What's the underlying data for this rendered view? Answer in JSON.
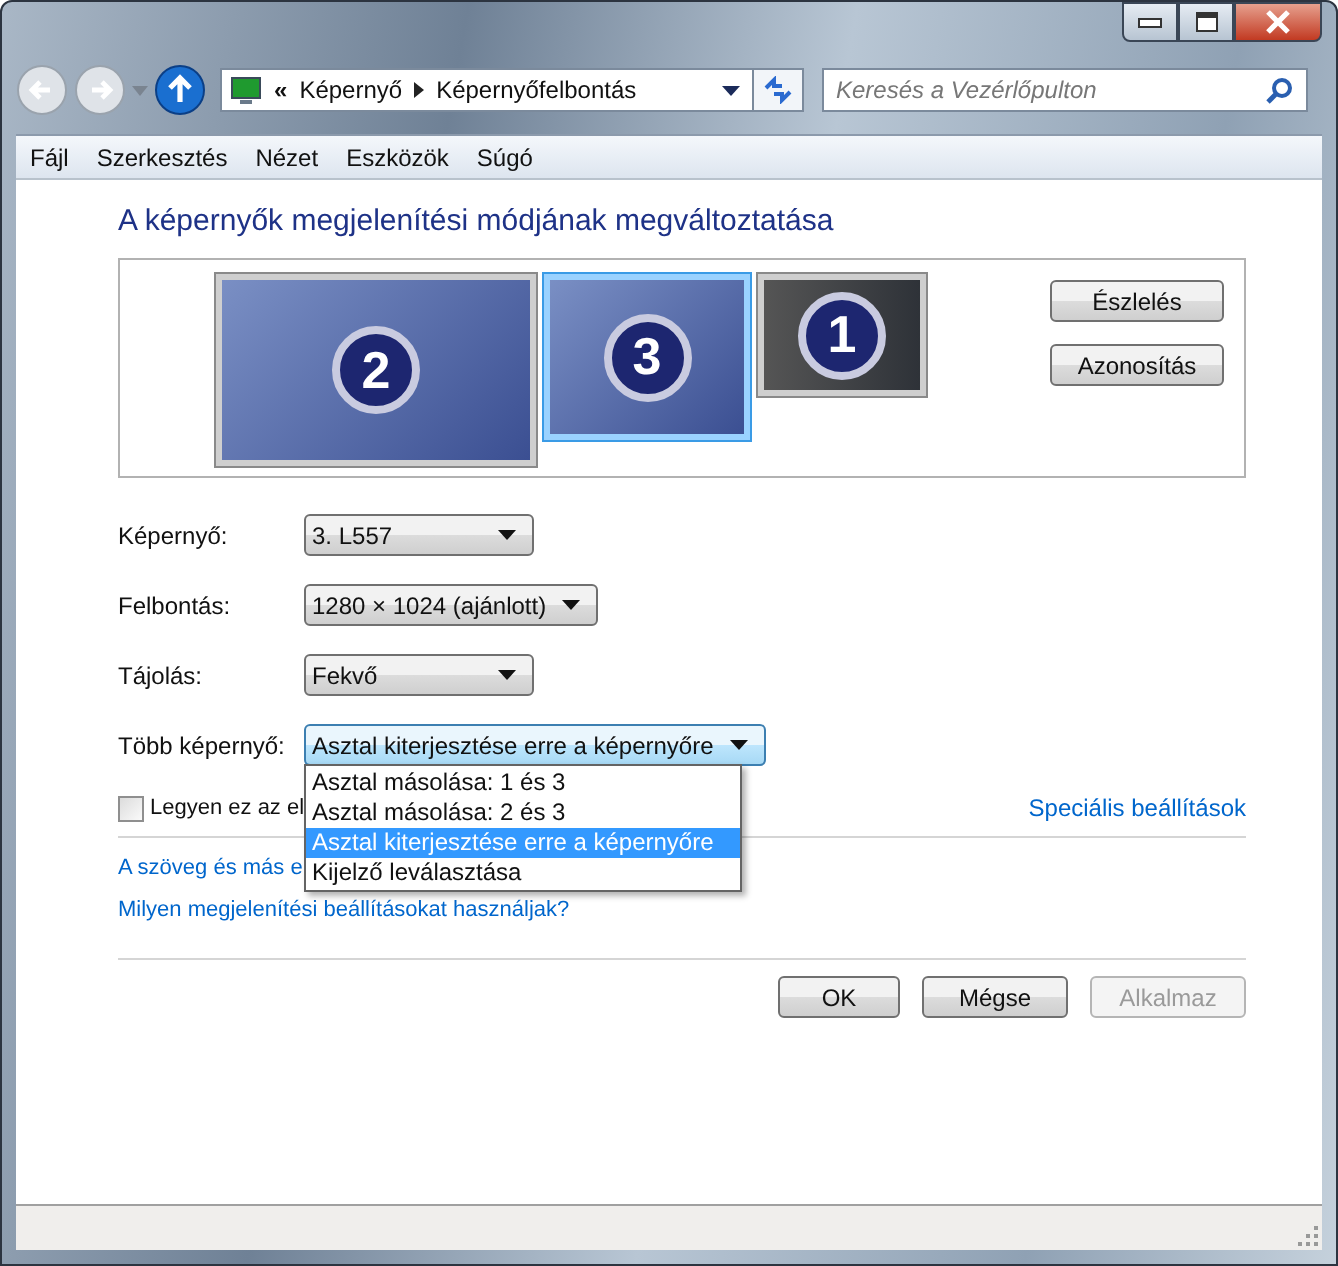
{
  "address_bar": {
    "overflow": "«",
    "breadcrumbs": [
      "Képernyő",
      "Képernyőfelbontás"
    ]
  },
  "search": {
    "placeholder": "Keresés a Vezérlőpulton"
  },
  "menu": [
    "Fájl",
    "Szerkesztés",
    "Nézet",
    "Eszközök",
    "Súgó"
  ],
  "heading": "A képernyők megjelenítési módjának megváltoztatása",
  "monitors": [
    {
      "number": "2",
      "selected": false,
      "active": true
    },
    {
      "number": "3",
      "selected": true,
      "active": true
    },
    {
      "number": "1",
      "selected": false,
      "active": false
    }
  ],
  "side_buttons": [
    "Észlelés",
    "Azonosítás"
  ],
  "fields": [
    {
      "label": "Képernyő:",
      "value": "3. L557"
    },
    {
      "label": "Felbontás:",
      "value": "1280 × 1024 (ajánlott)"
    },
    {
      "label": "Tájolás:",
      "value": "Fekvő"
    },
    {
      "label": "Több képernyő:",
      "value": "Asztal kiterjesztése erre a képernyőre",
      "expanded": true
    }
  ],
  "dropdown_options": [
    {
      "label": "Asztal másolása: 1 és 3",
      "selected": false
    },
    {
      "label": "Asztal másolása: 2 és 3",
      "selected": false
    },
    {
      "label": "Asztal kiterjesztése erre a képernyőre",
      "selected": true
    },
    {
      "label": "Kijelző leválasztása",
      "selected": false
    }
  ],
  "checkbox": {
    "label": "Legyen ez az el",
    "checked": false
  },
  "advanced_link": "Speciális beállítások",
  "links": [
    "A szöveg és más e",
    "Milyen megjelenítési beállításokat használjak?"
  ],
  "buttons": [
    {
      "label": "OK",
      "disabled": false
    },
    {
      "label": "Mégse",
      "disabled": false
    },
    {
      "label": "Alkalmaz",
      "disabled": true
    }
  ]
}
